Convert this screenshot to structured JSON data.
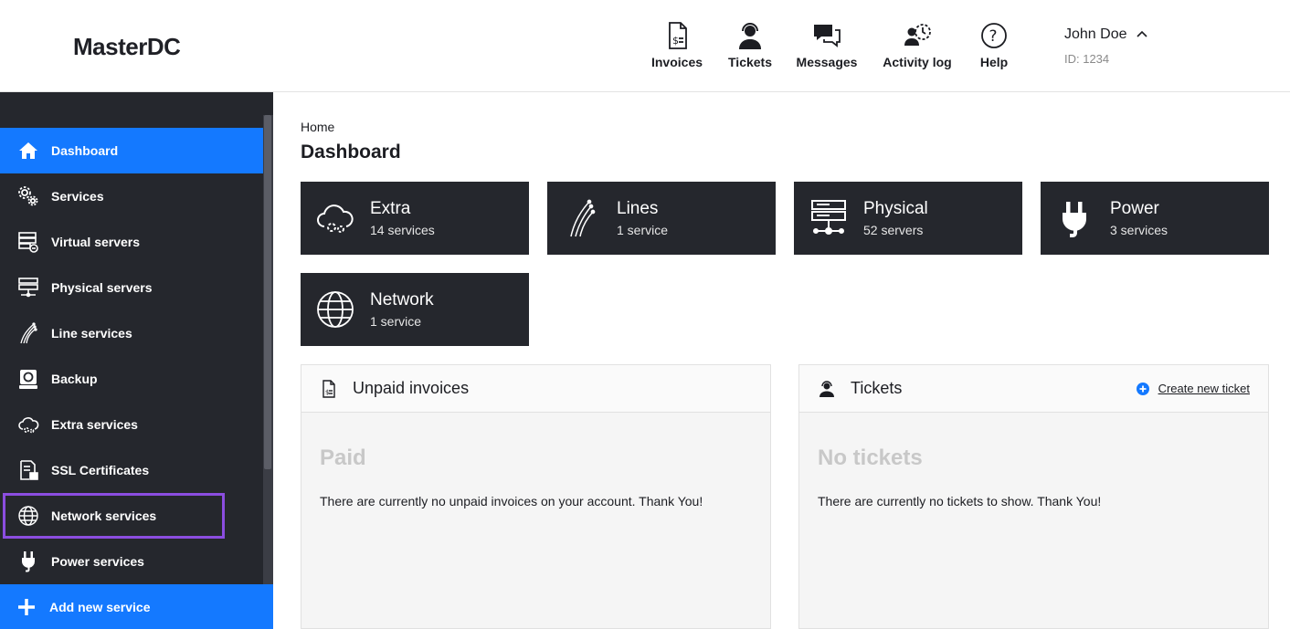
{
  "header": {
    "logo": "MasterDC",
    "nav": [
      {
        "label": "Invoices",
        "icon": "invoice-icon"
      },
      {
        "label": "Tickets",
        "icon": "support-agent-icon"
      },
      {
        "label": "Messages",
        "icon": "chat-icon"
      },
      {
        "label": "Activity log",
        "icon": "activity-log-icon"
      },
      {
        "label": "Help",
        "icon": "help-icon"
      }
    ],
    "user": {
      "name": "John Doe",
      "id": "ID: 1234"
    }
  },
  "sidebar": {
    "items": [
      {
        "label": "Dashboard",
        "icon": "home-icon",
        "active": true
      },
      {
        "label": "Services",
        "icon": "gears-icon"
      },
      {
        "label": "Virtual servers",
        "icon": "virtual-server-icon"
      },
      {
        "label": "Physical servers",
        "icon": "physical-server-icon"
      },
      {
        "label": "Line services",
        "icon": "fiber-icon"
      },
      {
        "label": "Backup",
        "icon": "backup-icon"
      },
      {
        "label": "Extra services",
        "icon": "cloud-gear-icon"
      },
      {
        "label": "SSL Certificates",
        "icon": "certificate-icon"
      },
      {
        "label": "Network services",
        "icon": "globe-icon",
        "highlighted": true
      },
      {
        "label": "Power services",
        "icon": "plug-icon"
      }
    ],
    "add_label": "Add new service"
  },
  "main": {
    "breadcrumb": "Home",
    "title": "Dashboard",
    "tiles": [
      {
        "name": "Extra",
        "count": "14 services",
        "icon": "cloud-gear-icon"
      },
      {
        "name": "Lines",
        "count": "1 service",
        "icon": "fiber-icon"
      },
      {
        "name": "Physical",
        "count": "52 servers",
        "icon": "physical-server-icon"
      },
      {
        "name": "Power",
        "count": "3 services",
        "icon": "plug-icon"
      },
      {
        "name": "Network",
        "count": "1 service",
        "icon": "globe-icon"
      }
    ],
    "invoices_panel": {
      "title": "Unpaid invoices",
      "state": "Paid",
      "message": "There are currently no unpaid invoices on your account. Thank You!"
    },
    "tickets_panel": {
      "title": "Tickets",
      "link": "Create new ticket",
      "state": "No tickets",
      "message": "There are currently no tickets to show. Thank You!"
    }
  },
  "colors": {
    "accent": "#1479ff",
    "sidebar": "#25272d",
    "highlight": "#8b4de0"
  }
}
